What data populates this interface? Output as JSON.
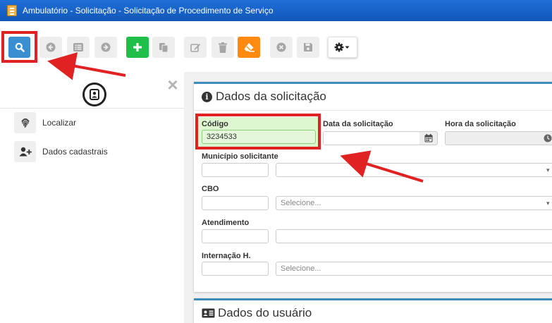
{
  "window": {
    "title": "Ambulatório - Solicitação - Solicitação de Procedimento de Serviço"
  },
  "toolbar": {
    "buttons": [
      {
        "name": "search-button",
        "icon": "search-icon"
      },
      {
        "name": "prev-button",
        "icon": "arrow-left-circle-icon"
      },
      {
        "name": "list-button",
        "icon": "list-icon"
      },
      {
        "name": "next-button",
        "icon": "arrow-right-circle-icon"
      },
      {
        "name": "add-button",
        "icon": "plus-icon"
      },
      {
        "name": "copy-button",
        "icon": "copy-icon"
      },
      {
        "name": "edit-button",
        "icon": "edit-icon"
      },
      {
        "name": "delete-button",
        "icon": "trash-icon"
      },
      {
        "name": "eraser-button",
        "icon": "eraser-icon"
      },
      {
        "name": "cancel-button",
        "icon": "times-circle-icon"
      },
      {
        "name": "save-button",
        "icon": "save-icon"
      },
      {
        "name": "settings-button",
        "icon": "gear-caret-icon"
      }
    ]
  },
  "sidebar": {
    "header_icon": "contact-card-icon",
    "close_icon": "close-icon",
    "items": [
      {
        "label": "Localizar",
        "icon": "fingerprint-icon"
      },
      {
        "label": "Dados cadastrais",
        "icon": "user-plus-icon"
      }
    ]
  },
  "section_solicitacao": {
    "title": "Dados da solicitação",
    "icon": "info-circle-icon",
    "fields": {
      "codigo": {
        "label": "Código",
        "value": "3234533"
      },
      "data": {
        "label": "Data da solicitação",
        "value": ""
      },
      "hora": {
        "label": "Hora da solicitação",
        "value": ""
      },
      "municipio": {
        "label": "Município solicitante",
        "code": "",
        "value": ""
      },
      "cbo": {
        "label": "CBO",
        "code": "",
        "select": "Selecione..."
      },
      "atendimento": {
        "label": "Atendimento",
        "code": "",
        "value": ""
      },
      "internacao": {
        "label": "Internação H.",
        "code": "",
        "select": "Selecione..."
      }
    }
  },
  "section_usuario": {
    "title": "Dados do usuário",
    "icon": "id-card-icon"
  },
  "colors": {
    "titlebar": "#1662c4",
    "search_button": "#3a8fd0",
    "add_button": "#1fbf48",
    "eraser_button": "#ff8a12",
    "highlight": "#e02222",
    "panel_accent": "#3c8dbc",
    "codigo_bg": "#ddf7d0"
  }
}
